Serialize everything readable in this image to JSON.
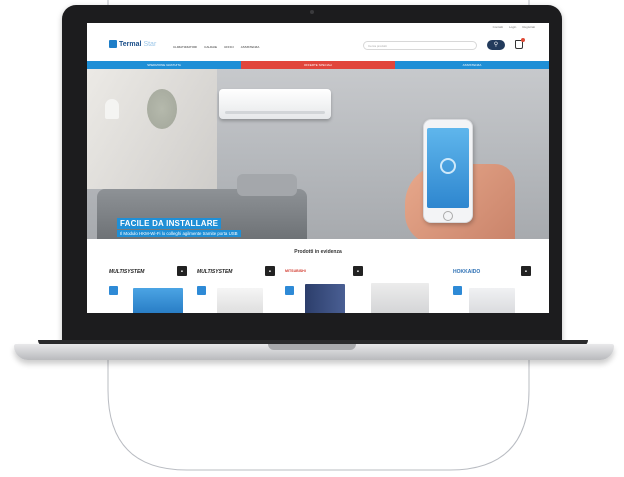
{
  "site": {
    "logo": {
      "text_main": "Termal",
      "text_accent": "Star"
    },
    "top_links": [
      "Contatti",
      "Login",
      "Registrati"
    ],
    "nav": [
      "CLIMATIZZATORI",
      "CALDAIE",
      "UFFICI",
      "ASSISTENZA"
    ],
    "search_placeholder": "Cerca prodotti",
    "search_icon": "search-icon",
    "cart_icon": "cart-icon",
    "promo": [
      "SPEDIZIONE GRATUITA",
      "OFFERTE SPECIALI",
      "ASSISTENZA"
    ],
    "hero": {
      "title": "FACILE DA INSTALLARE",
      "subtitle": "Il Modulo HKM-Wi-Fi lo colleghi agilmente tramite porta USB"
    },
    "section_title": "Prodotti in evidenza",
    "products": [
      {
        "brand": "MULTISYSTEM"
      },
      {
        "brand": "MULTISYSTEM"
      },
      {
        "brand": "MITSUBISHI"
      },
      {
        "brand": "HOKKAIDO"
      }
    ],
    "colors": {
      "accent": "#1f8fd6",
      "promo_red": "#e1453b",
      "navy": "#233b5c"
    }
  }
}
